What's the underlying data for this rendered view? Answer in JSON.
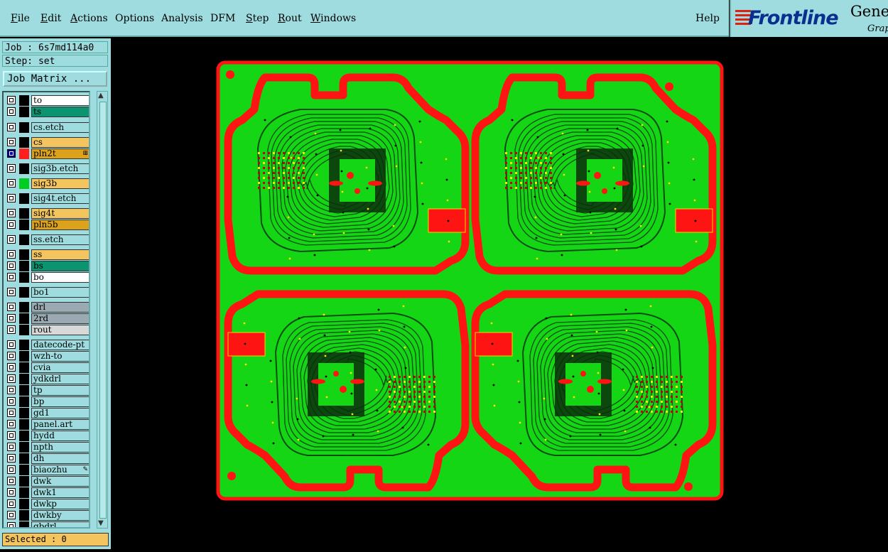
{
  "menu": {
    "items": [
      "File",
      "Edit",
      "Actions",
      "Options",
      "Analysis",
      "DFM",
      "Step",
      "Rout",
      "Windows"
    ],
    "help": "Help"
  },
  "logo": {
    "brand": "Frontline",
    "product": "Gene",
    "sub": "Grap"
  },
  "job_label": "Job : 6s7md114a0",
  "step_label": "Step: set",
  "job_matrix_button": "Job Matrix ...",
  "layers": [
    {
      "name": "to",
      "color": "#ffffff",
      "checked": false
    },
    {
      "name": "ts",
      "color": "#0c9470",
      "checked": false
    },
    {
      "name": "cs.etch",
      "color": "#9fdcdf",
      "checked": false
    },
    {
      "name": "cs",
      "color": "#f4c45e",
      "checked": false
    },
    {
      "name": "pln2t",
      "color": "#dca21c",
      "checked": true,
      "swatch": "#ff1f1f",
      "mark": "⊞"
    },
    {
      "name": "sig3b.etch",
      "color": "#9fdcdf",
      "checked": false
    },
    {
      "name": "sig3b",
      "color": "#f4c45e",
      "checked": false,
      "swatch": "#00cc22"
    },
    {
      "name": "sig4t.etch",
      "color": "#9fdcdf",
      "checked": false
    },
    {
      "name": "sig4t",
      "color": "#f4c45e",
      "checked": false
    },
    {
      "name": "pln5b",
      "color": "#dca21c",
      "checked": false
    },
    {
      "name": "ss.etch",
      "color": "#9fdcdf",
      "checked": false
    },
    {
      "name": "ss",
      "color": "#f4c45e",
      "checked": false
    },
    {
      "name": "bs",
      "color": "#0c9470",
      "checked": false
    },
    {
      "name": "bo",
      "color": "#ffffff",
      "checked": false
    },
    {
      "name": "bo1",
      "color": "#9fdcdf",
      "checked": false
    },
    {
      "name": "drl",
      "color": "#9aa9b2",
      "checked": false
    },
    {
      "name": "2rd",
      "color": "#9aa9b2",
      "checked": false
    },
    {
      "name": "rout",
      "color": "#d8d8d8",
      "checked": false
    },
    {
      "name": "datecode-pt",
      "color": "#9fdcdf",
      "checked": false
    },
    {
      "name": "wzh-to",
      "color": "#9fdcdf",
      "checked": false
    },
    {
      "name": "cvia",
      "color": "#9fdcdf",
      "checked": false
    },
    {
      "name": "ydkdrl",
      "color": "#9fdcdf",
      "checked": false
    },
    {
      "name": "tp",
      "color": "#9fdcdf",
      "checked": false
    },
    {
      "name": "bp",
      "color": "#9fdcdf",
      "checked": false
    },
    {
      "name": "gd1",
      "color": "#9fdcdf",
      "checked": false
    },
    {
      "name": "panel.art",
      "color": "#9fdcdf",
      "checked": false
    },
    {
      "name": "hydd",
      "color": "#9fdcdf",
      "checked": false
    },
    {
      "name": "npth",
      "color": "#9fdcdf",
      "checked": false
    },
    {
      "name": "dh",
      "color": "#9fdcdf",
      "checked": false
    },
    {
      "name": "biaozhu",
      "color": "#9fdcdf",
      "checked": false,
      "mark": "✎"
    },
    {
      "name": "dwk",
      "color": "#9fdcdf",
      "checked": false
    },
    {
      "name": "dwk1",
      "color": "#9fdcdf",
      "checked": false
    },
    {
      "name": "dwkp",
      "color": "#9fdcdf",
      "checked": false
    },
    {
      "name": "dwkby",
      "color": "#9fdcdf",
      "checked": false
    },
    {
      "name": "gbdrl",
      "color": "#9fdcdf",
      "checked": false
    }
  ],
  "selected_label": "Selected : 0",
  "colors": {
    "panel_bg": "#9fdcdf",
    "board_green": "#15d615",
    "outline_red": "#ff1414",
    "trace_dark": "#0b4d12"
  },
  "icons": [
    "checkbox-icon",
    "scroll-up-arrow-icon",
    "scroll-down-arrow-icon",
    "frontline-logo-icon"
  ]
}
